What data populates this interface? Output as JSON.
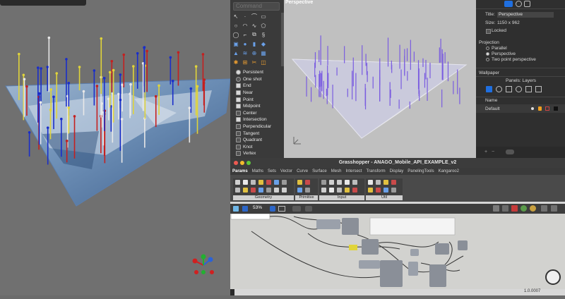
{
  "rhino": {
    "command_placeholder": "Command",
    "osnaps": [
      {
        "label": "Persistent",
        "type": "radio",
        "on": true
      },
      {
        "label": "One shot",
        "type": "radio",
        "on": false
      },
      {
        "label": "End",
        "type": "check",
        "on": true
      },
      {
        "label": "Near",
        "type": "check",
        "on": true
      },
      {
        "label": "Point",
        "type": "check",
        "on": true
      },
      {
        "label": "Midpoint",
        "type": "check",
        "on": true
      },
      {
        "label": "Center",
        "type": "check",
        "on": false
      },
      {
        "label": "Intersection",
        "type": "check",
        "on": true
      },
      {
        "label": "Perpendicular",
        "type": "check",
        "on": false
      },
      {
        "label": "Tangent",
        "type": "check",
        "on": false
      },
      {
        "label": "Quadrant",
        "type": "check",
        "on": false
      },
      {
        "label": "Knot",
        "type": "check",
        "on": false
      },
      {
        "label": "Vertex",
        "type": "check",
        "on": false
      }
    ],
    "tool_icons": [
      "arrow-icon",
      "point-icon",
      "polyline-icon",
      "rectangle-icon",
      "circle-icon",
      "arc-icon",
      "curve-icon",
      "polygon-icon",
      "ellipse-icon",
      "fillet-icon",
      "offset-icon",
      "helix-icon",
      "box-icon",
      "sphere-icon",
      "cylinder-icon",
      "surface-icon",
      "extrude-icon",
      "loft-icon",
      "boolean-icon",
      "mesh-icon",
      "explode-icon",
      "join-icon",
      "trim-icon",
      "split-icon"
    ],
    "viewport_label": "Perspective"
  },
  "properties": {
    "title_label": "Title:",
    "title_value": "Perspective",
    "size_label": "Size:",
    "size_value": "1150 x 962",
    "locked_label": "Locked",
    "projection_label": "Projection",
    "projections": [
      {
        "label": "Parallel",
        "on": false
      },
      {
        "label": "Perspective",
        "on": true
      },
      {
        "label": "Two point perspective",
        "on": false
      }
    ],
    "wallpaper_label": "Wallpaper",
    "panels_title": "Panels: Layers",
    "name_header": "Name",
    "layers": [
      {
        "name": "Default"
      }
    ]
  },
  "grasshopper": {
    "window_title": "Grasshopper - ANAGO_Mobile_API_EXAMPLE_v2",
    "tabs": [
      "Params",
      "Maths",
      "Sets",
      "Vector",
      "Curve",
      "Surface",
      "Mesh",
      "Intersect",
      "Transform",
      "Display",
      "PanelingTools",
      "Kangaroo2"
    ],
    "active_tab": "Params",
    "ribbon_groups": [
      "Geometry",
      "Primitive",
      "Input",
      "Util"
    ],
    "zoom": "53%",
    "version": "1.0.0007"
  },
  "colors": {
    "accent_blue": "#1f6fe0",
    "pin_blue": "#1a2ec9",
    "pin_red": "#c42020",
    "pin_yellow": "#e0d43a",
    "pin_white": "#e8e8e8",
    "persp_line": "#7a5ce0"
  }
}
